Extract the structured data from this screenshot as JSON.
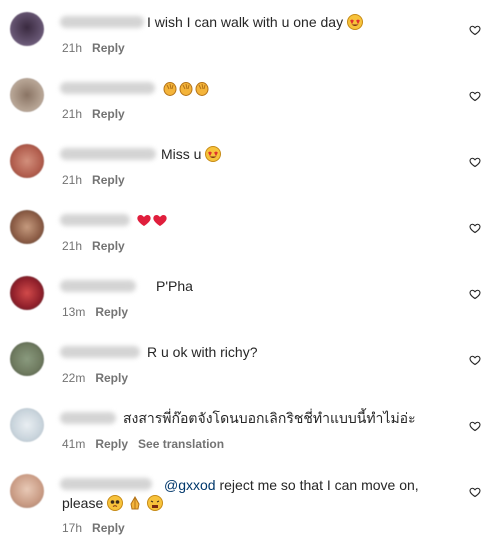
{
  "comments": [
    {
      "text": "I wish I can walk with u one day",
      "emojis": [
        "star-struck"
      ],
      "time": "21h",
      "reply": "Reply"
    },
    {
      "text": "",
      "emojis": [
        "clap",
        "clap",
        "clap"
      ],
      "time": "21h",
      "reply": "Reply"
    },
    {
      "text": "Miss u",
      "emojis": [
        "star-struck"
      ],
      "time": "21h",
      "reply": "Reply"
    },
    {
      "text": "",
      "emojis": [
        "red-heart",
        "red-heart"
      ],
      "time": "21h",
      "reply": "Reply"
    },
    {
      "text": "P'Pha",
      "emojis": [],
      "time": "13m",
      "reply": "Reply"
    },
    {
      "text": "R u ok with richy?",
      "emojis": [],
      "time": "22m",
      "reply": "Reply"
    },
    {
      "text": "สงสารพี่ก๊อตจังโดนบอกเลิกริชชี่ทำแบบนี้ทำไม่อ่ะ",
      "emojis": [],
      "time": "41m",
      "reply": "Reply",
      "see_translation": "See translation"
    },
    {
      "mention": "@gxxod",
      "text": " reject me so that I can move on,",
      "text2": "please",
      "emojis": [
        "pleading",
        "folded-hands",
        "weary"
      ],
      "time": "17h",
      "reply": "Reply"
    }
  ]
}
